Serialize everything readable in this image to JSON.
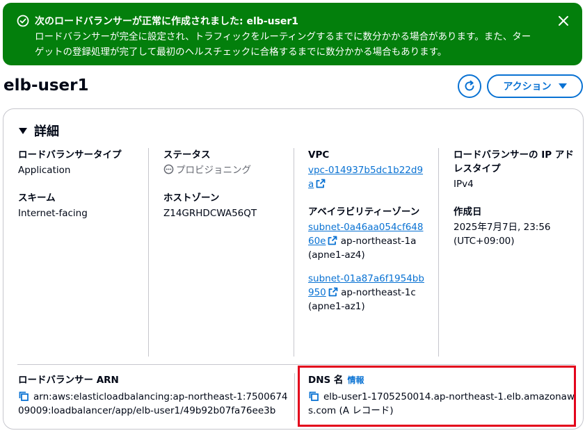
{
  "flash": {
    "title": "次のロードバランサーが正常に作成されました: elb-user1",
    "body": "ロードバランサーが完全に設定され、トラフィックをルーティングするまでに数分かかる場合があります。また、ターゲットの登録処理が完了して最初のヘルスチェックに合格するまでに数分かかる場合もあります。",
    "color": "#037f0c"
  },
  "header": {
    "title": "elb-user1",
    "action_label": "アクション"
  },
  "details": {
    "section_title": "詳細",
    "lb_type_label": "ロードバランサータイプ",
    "lb_type_value": "Application",
    "scheme_label": "スキーム",
    "scheme_value": "Internet-facing",
    "status_label": "ステータス",
    "status_value": "プロビジョニング",
    "hosted_zone_label": "ホストゾーン",
    "hosted_zone_value": "Z14GRHDCWA56QT",
    "vpc_label": "VPC",
    "vpc_value": "vpc-014937b5dc1b22d9a",
    "az_label": "アベイラビリティーゾーン",
    "subnets": [
      {
        "id": "subnet-0a46aa054cf64860e",
        "zone": "ap-northeast-1a (apne1-az4)"
      },
      {
        "id": "subnet-01a87a6f1954bb950",
        "zone": "ap-northeast-1c (apne1-az1)"
      }
    ],
    "ip_type_label": "ロードバランサーの IP アドレスタイプ",
    "ip_type_value": "IPv4",
    "created_label": "作成日",
    "created_value": "2025年7月7日, 23:56 (UTC+09:00)",
    "arn_label": "ロードバランサー ARN",
    "arn_value": "arn:aws:elasticloadbalancing:ap-northeast-1:750067409009:loadbalancer/app/elb-user1/49b92b07fa76ee3b",
    "dns_label": "DNS 名",
    "dns_info": "情報",
    "dns_value": "elb-user1-1705250014.ap-northeast-1.elb.amazonaws.com (A レコード)"
  },
  "colors": {
    "link": "#0972d3",
    "highlight": "#e3001b",
    "border": "#c6c6cd"
  }
}
